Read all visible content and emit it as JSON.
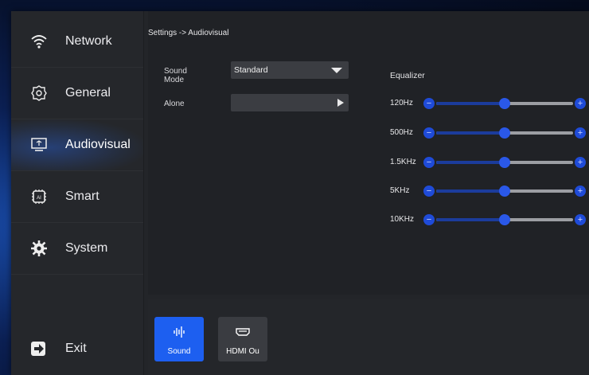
{
  "sidebar": {
    "items": [
      {
        "label": "Network",
        "icon": "wifi-icon"
      },
      {
        "label": "General",
        "icon": "gear-outline-icon"
      },
      {
        "label": "Audiovisual",
        "icon": "monitor-icon",
        "active": true
      },
      {
        "label": "Smart",
        "icon": "ai-chip-icon"
      },
      {
        "label": "System",
        "icon": "system-gear-icon"
      }
    ],
    "exit": {
      "label": "Exit",
      "icon": "exit-arrow-icon"
    }
  },
  "breadcrumb": "Settings -> Audiovisual",
  "sound_mode": {
    "label": "Sound Mode",
    "value": "Standard"
  },
  "alone": {
    "label": "Alone",
    "value": ""
  },
  "equalizer": {
    "title": "Equalizer",
    "bands": [
      {
        "label": "120Hz",
        "level": 0.5
      },
      {
        "label": "500Hz",
        "level": 0.5
      },
      {
        "label": "1.5KHz",
        "level": 0.5
      },
      {
        "label": "5KHz",
        "level": 0.5
      },
      {
        "label": "10KHz",
        "level": 0.5
      }
    ]
  },
  "bottom_tabs": [
    {
      "label": "Sound",
      "icon": "waveform-icon",
      "active": true
    },
    {
      "label": "HDMI Ou",
      "icon": "hdmi-port-icon",
      "active": false
    }
  ],
  "colors": {
    "accent": "#1d5ff0",
    "panel": "#232529",
    "slider_fill": "#1b3c9c"
  }
}
